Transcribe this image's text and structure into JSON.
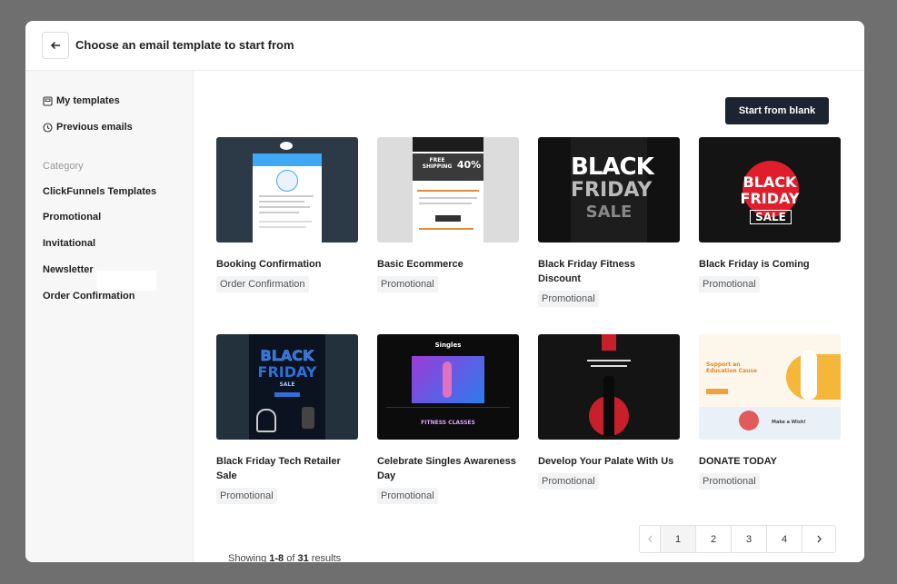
{
  "header": {
    "title": "Choose an email template to start from"
  },
  "sidebar": {
    "my_templates": "My templates",
    "previous_emails": "Previous emails",
    "category_label": "Category",
    "categories": [
      "ClickFunnels Templates",
      "Promotional",
      "Invitational",
      "Newsletter",
      "Order Confirmation"
    ]
  },
  "main": {
    "start_blank": "Start from blank",
    "cards": [
      {
        "title": "Booking Confirmation",
        "tag": "Order Confirmation"
      },
      {
        "title": "Basic Ecommerce",
        "tag": "Promotional"
      },
      {
        "title": "Black Friday Fitness Discount",
        "tag": "Promotional"
      },
      {
        "title": "Black Friday is Coming",
        "tag": "Promotional"
      },
      {
        "title": "Black Friday Tech Retailer Sale",
        "tag": "Promotional"
      },
      {
        "title": "Celebrate Singles Awareness Day",
        "tag": "Promotional"
      },
      {
        "title": "Develop Your Palate With Us",
        "tag": "Promotional"
      },
      {
        "title": "DONATE TODAY",
        "tag": "Promotional"
      }
    ],
    "thumbs": {
      "t2_text1": "FREE SHIPPING",
      "t2_text2": "40%",
      "t3_line1": "BLACK",
      "t3_line2": "FRIDAY",
      "t3_line3": "SALE",
      "t4_line1": "BLACK",
      "t4_line2": "FRIDAY",
      "t4_line3": "SALE",
      "t5_line1": "BLACK",
      "t5_line2": "FRIDAY",
      "t5_line3": "SALE",
      "t6_top": "Singles",
      "t6_sub": "FITNESS CLASSES",
      "t8_head": "Support an Education Cause",
      "t8_sub": "Make a Wish!"
    }
  },
  "footer": {
    "showing_prefix": "Showing ",
    "showing_range": "1-8",
    "showing_of": " of ",
    "showing_total": "31",
    "showing_suffix": " results",
    "pages": [
      "1",
      "2",
      "3",
      "4"
    ]
  },
  "colors": {
    "primary_dark": "#1b2430",
    "backdrop": "#6f6f6f"
  },
  "icons": {
    "back": "arrow-left-icon",
    "my_templates": "template-icon",
    "previous": "clock-icon",
    "prev": "chevron-left-icon",
    "next": "chevron-right-icon"
  }
}
